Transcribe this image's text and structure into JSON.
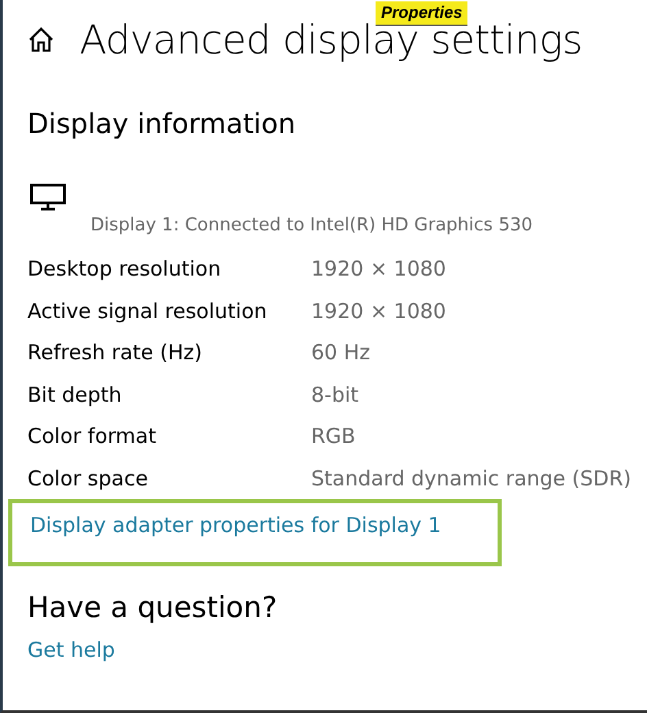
{
  "window": {
    "title": "Advanced display settings"
  },
  "callout": {
    "label": "Properties"
  },
  "section": {
    "heading": "Display information",
    "display": "Display 1: Connected to Intel(R) HD Graphics 530",
    "rows": [
      {
        "label": "Desktop resolution",
        "value": "1920 × 1080"
      },
      {
        "label": "Active signal resolution",
        "value": "1920 × 1080"
      },
      {
        "label": "Refresh rate (Hz)",
        "value": "60 Hz"
      },
      {
        "label": "Bit depth",
        "value": "8-bit"
      },
      {
        "label": "Color format",
        "value": "RGB"
      },
      {
        "label": "Color space",
        "value": "Standard dynamic range (SDR)"
      }
    ],
    "link": {
      "label": "Display adapter properties for Display 1",
      "highlighted": true
    }
  },
  "help": {
    "heading": "Have a question?",
    "link": "Get help"
  }
}
